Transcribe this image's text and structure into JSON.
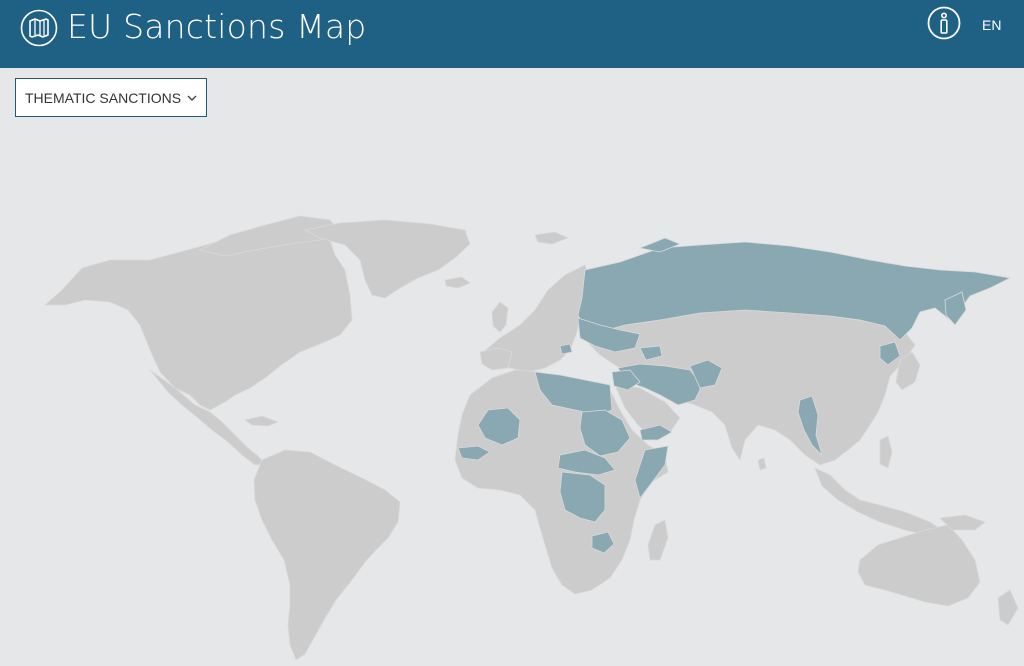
{
  "header": {
    "title": "EU Sanctions Map",
    "language": "EN",
    "logo_icon": "map-icon",
    "info_icon": "info-icon",
    "background_color": "#1f6184"
  },
  "filter": {
    "selected": "THEMATIC SANCTIONS",
    "chevron_icon": "chevron-down-icon"
  },
  "map": {
    "land_color": "#cccccc",
    "sanctioned_color": "#8aa8b2",
    "ocean_color": "#e6e7e8"
  }
}
